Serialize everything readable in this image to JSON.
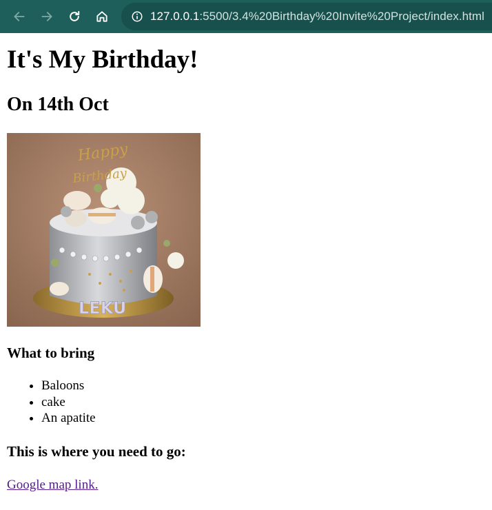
{
  "browser": {
    "back_icon": "arrow-left-icon",
    "forward_icon": "arrow-right-icon",
    "reload_icon": "reload-icon",
    "home_icon": "home-icon",
    "info_icon": "info-icon",
    "url_host": "127.0.0.1",
    "url_path": ":5500/3.4%20Birthday%20Invite%20Project/index.html",
    "toolbar_color": "#1f5f5b"
  },
  "page": {
    "title": "It's My Birthday!",
    "date": "On 14th Oct",
    "cake_image_text": "LEKU",
    "bring_heading": "What to bring",
    "bring_items": [
      "Baloons",
      "cake",
      "An apatite"
    ],
    "where_heading": "This is where you need to go:",
    "map_link": "Google map link.",
    "link_color": "#551a8b"
  }
}
